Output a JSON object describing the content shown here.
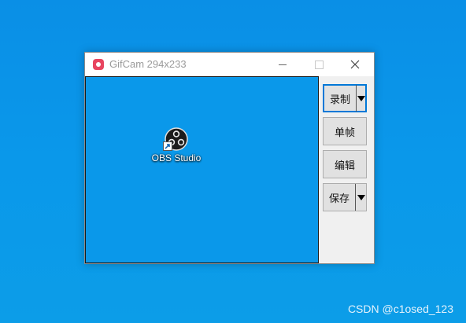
{
  "window": {
    "title": "GifCam 294x233",
    "controls": {
      "minimize_icon": "minimize-icon",
      "maximize_icon": "maximize-icon",
      "close_icon": "close-icon",
      "close_glyph": "✕"
    }
  },
  "capture_area": {
    "shortcut": {
      "label": "OBS Studio",
      "icon": "obs-studio-icon",
      "overlay_icon": "shortcut-arrow-icon"
    }
  },
  "buttons": {
    "record": "录制",
    "single_frame": "单帧",
    "edit": "编辑",
    "save": "保存"
  },
  "watermark": "CSDN @c1osed_123",
  "colors": {
    "desktop": "#0a98ea",
    "accent": "#0078d7",
    "app_icon": "#e8455f"
  }
}
